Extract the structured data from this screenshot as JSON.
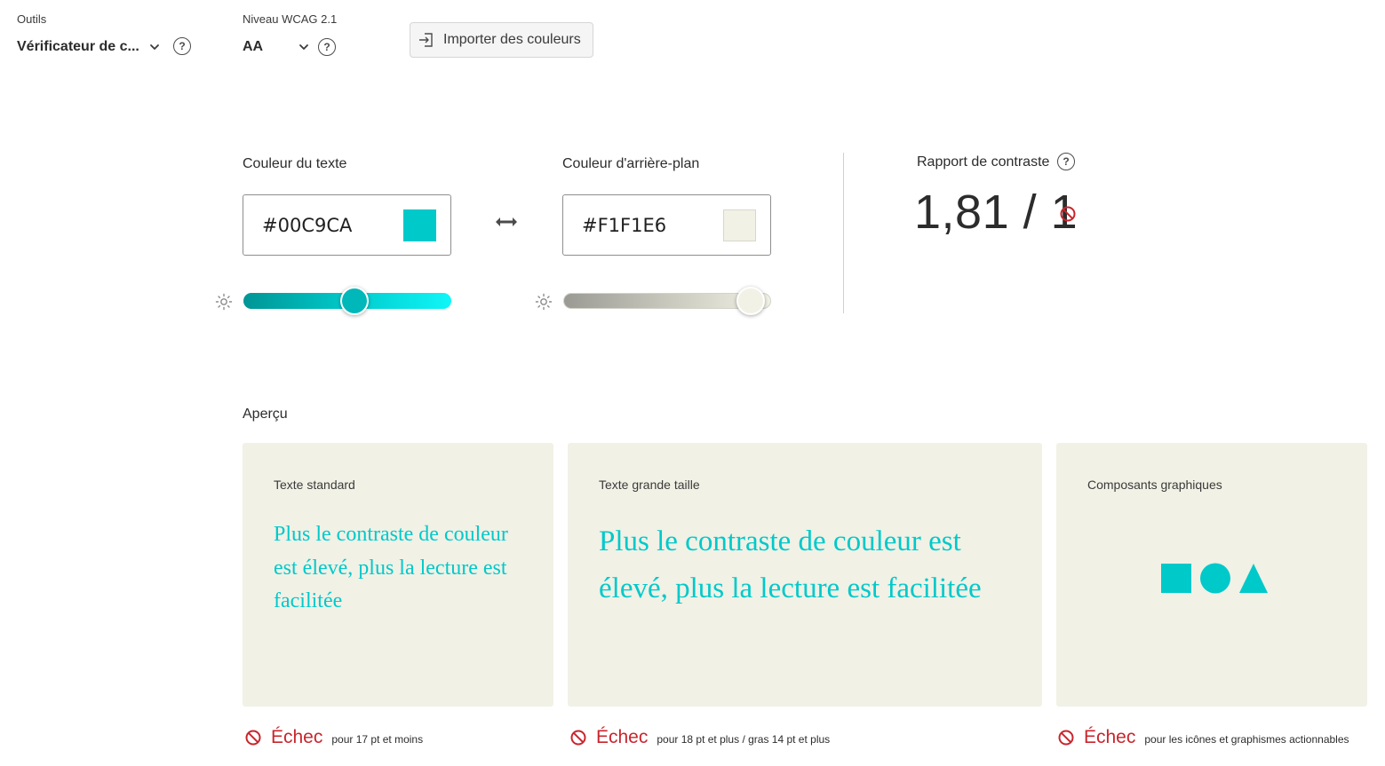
{
  "toolbar": {
    "tools_label": "Outils",
    "tools_value": "Vérificateur de c...",
    "wcag_label": "Niveau WCAG 2.1",
    "wcag_value": "AA",
    "import_label": "Importer des couleurs"
  },
  "text_color": {
    "label": "Couleur du texte",
    "hex": "#00C9CA",
    "color": "#00C9CA"
  },
  "background_color": {
    "label": "Couleur d'arrière-plan",
    "hex": "#F1F1E6",
    "color": "#F1F1E6"
  },
  "contrast": {
    "label": "Rapport de contraste",
    "value": "1,81 / 1"
  },
  "preview": {
    "label": "Aperçu",
    "cards": [
      {
        "title": "Texte standard",
        "text": "Plus le contraste de couleur est élevé, plus la lecture est facilitée",
        "status": "Échec",
        "status_desc": "pour 17 pt et moins"
      },
      {
        "title": "Texte grande taille",
        "text": "Plus le contraste de couleur est élevé, plus la lecture est facilitée",
        "status": "Échec",
        "status_desc": "pour 18 pt et plus / gras 14 pt et plus"
      },
      {
        "title": "Composants graphiques",
        "status": "Échec",
        "status_desc": "pour les icônes et graphismes actionnables"
      }
    ]
  },
  "colors": {
    "fail": "#C9252D",
    "accent": "#00C9CA",
    "card_bg": "#F1F1E6"
  }
}
